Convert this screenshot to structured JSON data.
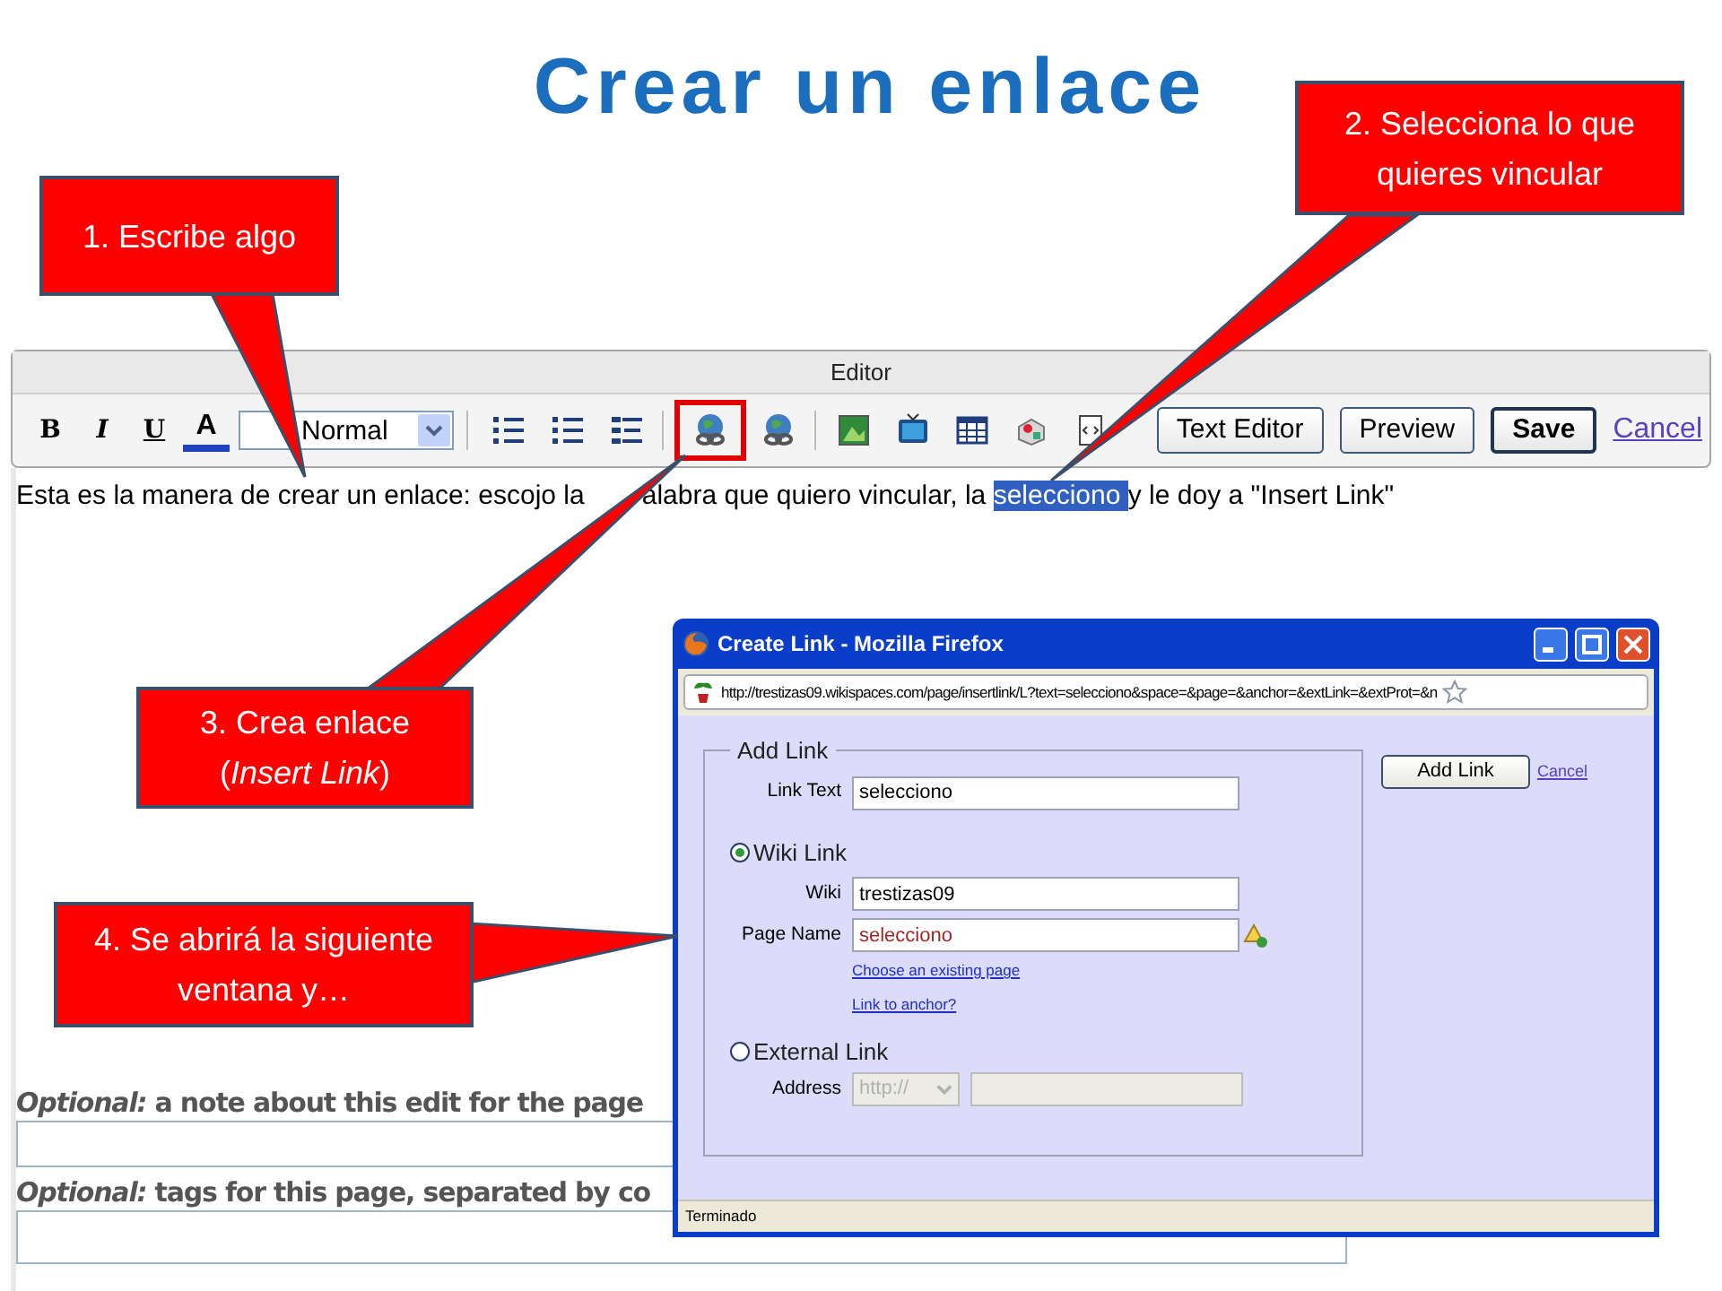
{
  "title": "Crear un enlace",
  "callouts": [
    {
      "text": "1. Escribe algo"
    },
    {
      "text": "2. Selecciona lo que quieres vincular"
    },
    {
      "text": "3. Crea enlace (*Insert Link*)"
    },
    {
      "text": "4. Se abrirá la siguiente ventana y…"
    }
  ],
  "editor": {
    "title": "Editor",
    "format_buttons": [
      {
        "kind": "bold",
        "label": "B"
      },
      {
        "kind": "italic",
        "label": "I"
      },
      {
        "kind": "underline",
        "label": "U"
      },
      {
        "kind": "color",
        "label": "A"
      }
    ],
    "style_select": "Normal",
    "tools": [
      {
        "kind": "numbered-list",
        "highlighted": false
      },
      {
        "kind": "bullet-list",
        "highlighted": false
      },
      {
        "kind": "indent",
        "highlighted": false
      },
      {
        "kind": "link",
        "highlighted": true
      },
      {
        "kind": "unlink",
        "highlighted": false
      },
      {
        "kind": "image",
        "highlighted": false
      },
      {
        "kind": "video",
        "highlighted": false
      },
      {
        "kind": "table",
        "highlighted": false
      },
      {
        "kind": "widget",
        "highlighted": false
      },
      {
        "kind": "code",
        "highlighted": false
      }
    ],
    "buttons": [
      {
        "label": "Text Editor",
        "primary": false
      },
      {
        "label": "Preview",
        "primary": false
      },
      {
        "label": "Save",
        "primary": true
      }
    ],
    "cancel": "Cancel"
  },
  "content": {
    "before": "Esta es la manera de crear un enlace: escojo la",
    "before_2": "alabra que quiero vincular, la ",
    "selected": "selecciono ",
    "after": "y le doy a \"Insert Link\""
  },
  "optional_fields": [
    {
      "label": "*Optional:* a note about this edit for the page"
    },
    {
      "label": "*Optional:* tags for this page, separated by co"
    }
  ],
  "dialog": {
    "title": "Create Link - Mozilla Firefox",
    "url": "http://trestizas09.wikispaces.com/page/insertlink/L?text=selecciono&space=&page=&anchor=&extLink=&extProt=&n",
    "legend": "Add Link",
    "link_text": {
      "label": "Link Text",
      "value": "selecciono"
    },
    "options": [
      {
        "label": "Wiki Link",
        "selected": true
      },
      {
        "label": "External Link",
        "selected": false
      }
    ],
    "wiki": {
      "label": "Wiki",
      "value": "trestizas09"
    },
    "page_name": {
      "label": "Page Name",
      "value": "selecciono"
    },
    "links": [
      "Choose an existing page",
      "Link to anchor?"
    ],
    "address": {
      "label": "Address",
      "protocol": "http://",
      "disabled": true
    },
    "add_button": "Add Link",
    "cancel": "Cancel",
    "status": "Terminado"
  }
}
